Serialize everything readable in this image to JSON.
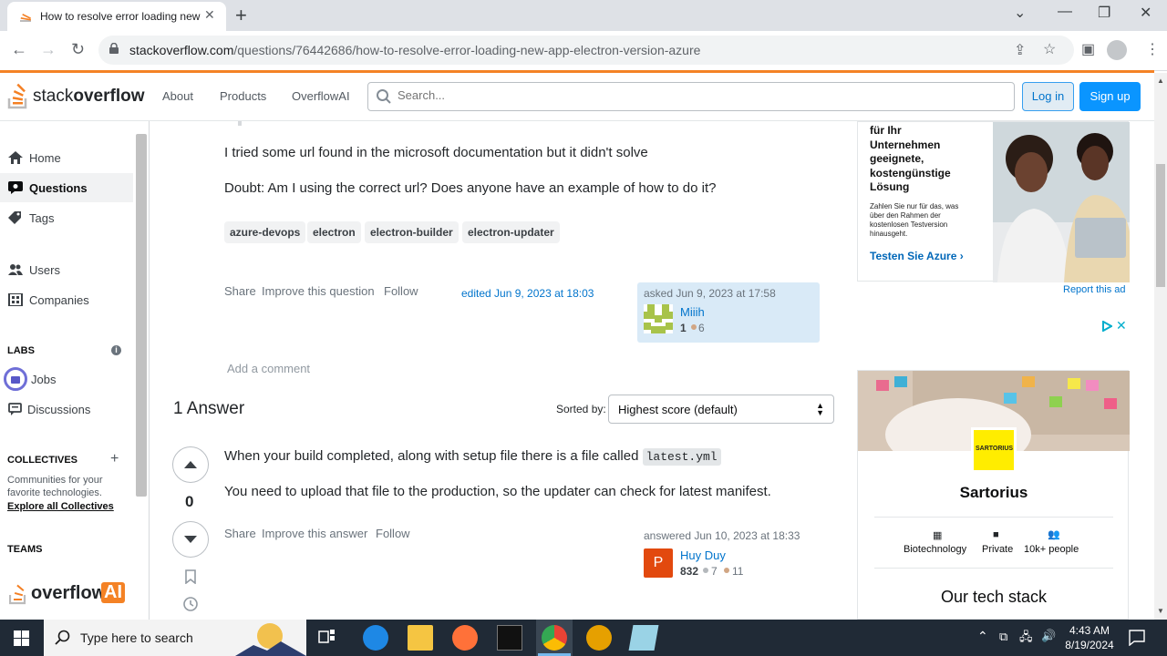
{
  "browser": {
    "tab_title": "How to resolve error loading new",
    "url_domain": "stackoverflow.com",
    "url_path": "/questions/76442686/how-to-resolve-error-loading-new-app-electron-version-azure"
  },
  "header": {
    "logo_text_light": "stack",
    "logo_text_bold": "overflow",
    "nav": [
      "About",
      "Products",
      "OverflowAI"
    ],
    "search_placeholder": "Search...",
    "login": "Log in",
    "signup": "Sign up"
  },
  "sidebar": {
    "items": [
      {
        "label": "Home",
        "icon": "home-icon"
      },
      {
        "label": "Questions",
        "icon": "questions-icon"
      },
      {
        "label": "Tags",
        "icon": "tag-icon"
      },
      {
        "label": "Users",
        "icon": "users-icon"
      },
      {
        "label": "Companies",
        "icon": "companies-icon"
      }
    ],
    "labs": "LABS",
    "labs_items": [
      {
        "label": "Jobs",
        "icon": "briefcase-icon"
      },
      {
        "label": "Discussions",
        "icon": "discussion-icon"
      }
    ],
    "collectives": "COLLECTIVES",
    "collectives_desc_1": "Communities for your",
    "collectives_desc_2": "favorite technologies.",
    "collectives_link": "Explore all Collectives",
    "teams": "TEAMS",
    "overflow_ai_text": "overflow",
    "overflow_ai_badge": "AI"
  },
  "question": {
    "para1": "I tried some url found in the microsoft documentation but it didn't solve",
    "para2": "Doubt: Am I using the correct url? Does anyone have an example of how to do it?",
    "tags": [
      "azure-devops",
      "electron",
      "electron-builder",
      "electron-updater"
    ],
    "actions": [
      "Share",
      "Improve this question",
      "Follow"
    ],
    "edited": "edited Jun 9, 2023 at 18:03",
    "asked": "asked Jun 9, 2023 at 17:58",
    "user": "Miiih",
    "rep": "1",
    "bronze": "6",
    "add_comment": "Add a comment"
  },
  "answers": {
    "count_label": "1 Answer",
    "sorted_by": "Sorted by:",
    "sort_value": "Highest score (default)",
    "score": "0",
    "line1_pre": "When your build completed, along with setup file there is a file called",
    "line1_code": "latest.yml",
    "line2": "You need to upload that file to the production, so the updater can check for latest manifest.",
    "actions": [
      "Share",
      "Improve this answer",
      "Follow"
    ],
    "answered": "answered Jun 10, 2023 at 18:33",
    "user": "Huy Duy",
    "avatar_letter": "P",
    "rep": "832",
    "silver": "7",
    "bronze": "11"
  },
  "ads": {
    "azure_lines": [
      "für Ihr",
      "Unternehmen",
      "geeignete,",
      "kostengünstige",
      "Lösung"
    ],
    "azure_small": [
      "Zahlen Sie nur für das, was",
      "über den Rahmen der",
      "kostenlosen Testversion",
      "hinausgeht."
    ],
    "azure_cta": "Testen Sie Azure",
    "report": "Report this ad",
    "sartorius_logo": "SARTORIUS",
    "sartorius_name": "Sartorius",
    "facts": [
      {
        "label": "Biotechnology",
        "icon": "building-icon"
      },
      {
        "label": "Private",
        "icon": "briefcase-icon"
      },
      {
        "label": "10k+ people",
        "icon": "people-icon"
      }
    ],
    "tech_stack": "Our tech stack"
  },
  "taskbar": {
    "search_placeholder": "Type here to search",
    "time": "4:43 AM",
    "date": "8/19/2024"
  },
  "colors": {
    "orange": "#f48225",
    "blue": "#0a95ff",
    "link": "#0074cc"
  }
}
